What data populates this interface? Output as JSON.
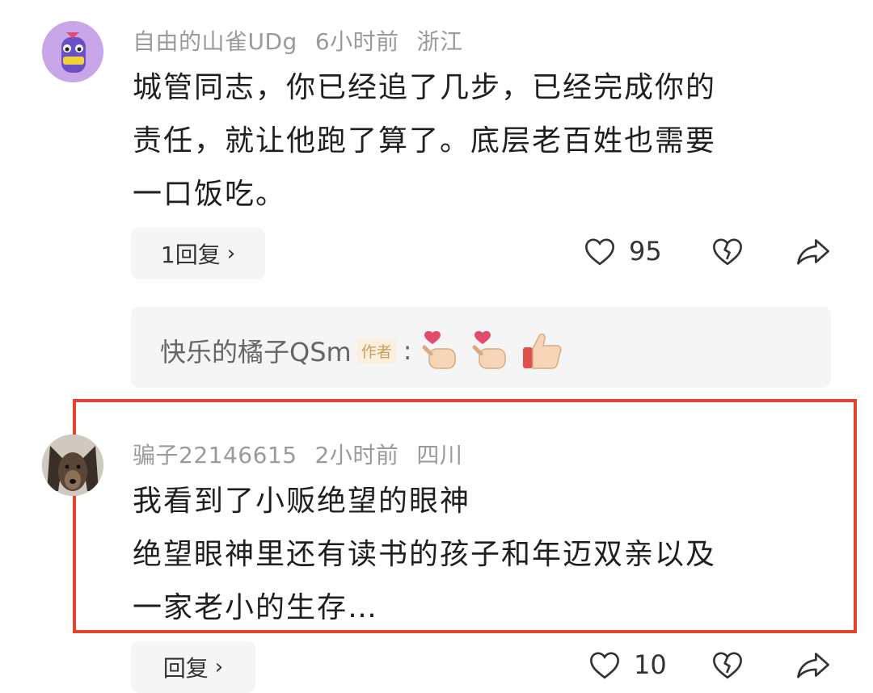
{
  "comments": [
    {
      "username": "自由的山雀UDg",
      "time": "6小时前",
      "location": "浙江",
      "lines": [
        "城管同志，你已经追了几步，已经完成你的",
        "责任，就让他跑了算了。底层老百姓也需要",
        "一口饭吃。"
      ],
      "reply_label": "1回复",
      "likes": "95"
    },
    {
      "username": "骗子22146615",
      "time": "2小时前",
      "location": "四川",
      "lines": [
        "我看到了小贩绝望的眼神",
        "绝望眼神里还有读书的孩子和年迈双亲以及",
        "一家老小的生存…"
      ],
      "reply_label": "回复",
      "likes": "10"
    }
  ],
  "sub_reply": {
    "username": "快乐的橘子QSm",
    "badge": "作者",
    "colon": ":",
    "emojis": [
      "finger-heart",
      "finger-heart",
      "thumbs-up"
    ]
  },
  "colors": {
    "highlight": "#e0442d",
    "meta": "#9a9a9a",
    "pill_bg": "#f5f5f5"
  }
}
